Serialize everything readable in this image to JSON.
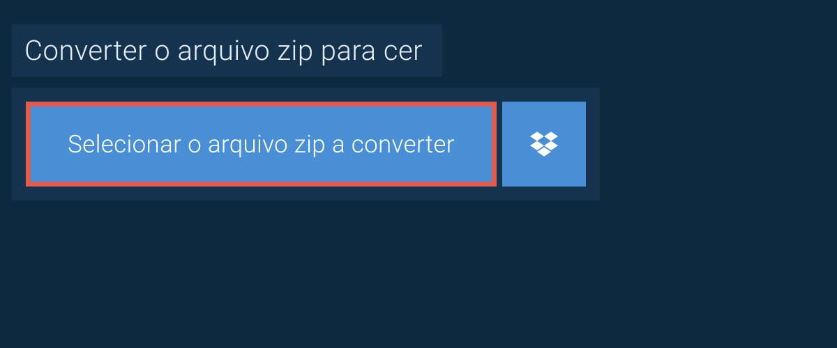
{
  "header": {
    "title": "Converter o arquivo zip para cer"
  },
  "main": {
    "select_button_label": "Selecionar o arquivo zip a converter"
  },
  "colors": {
    "page_bg": "#0f2940",
    "panel_bg": "#15334f",
    "button_bg": "#4a8fd6",
    "highlight_border": "#e05c52",
    "text_light": "#e6eef5",
    "text_white": "#ffffff"
  }
}
